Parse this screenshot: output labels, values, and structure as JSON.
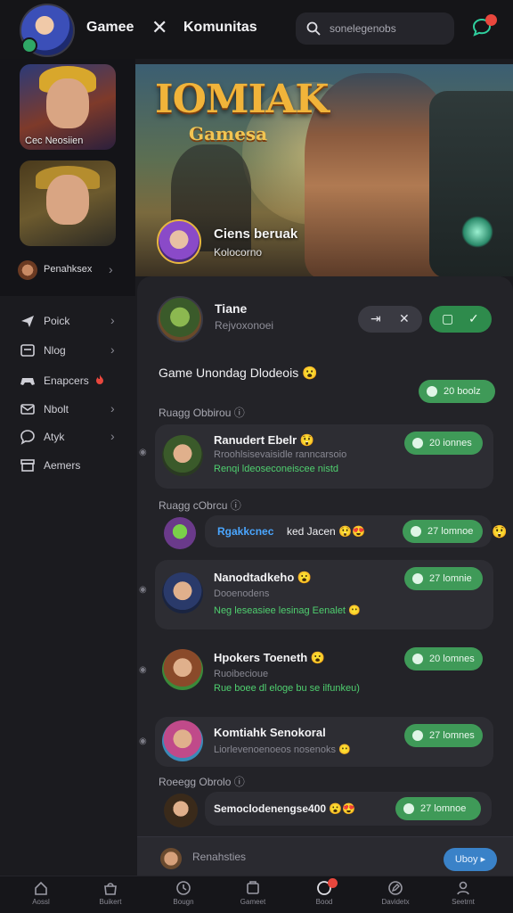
{
  "header": {
    "brand": "Gamee",
    "divider_symbol": "✕",
    "community": "Komunitas",
    "search_placeholder": "sonelegenobs"
  },
  "left_panel": {
    "thumbs": [
      {
        "label": "Cec Neosiien"
      },
      {
        "label": ""
      }
    ],
    "user": {
      "name": "Penahksex"
    }
  },
  "sidebar": {
    "items": [
      {
        "label": "Poick",
        "has_chevron": true
      },
      {
        "label": "Nlog",
        "has_chevron": true
      },
      {
        "label": "Enapcers",
        "has_chevron": false
      },
      {
        "label": "Nbolt",
        "has_chevron": true
      },
      {
        "label": "Atyk",
        "has_chevron": true
      },
      {
        "label": "Aemers",
        "has_chevron": false
      }
    ]
  },
  "hero": {
    "logo": "IOMIAK",
    "logo_sub": "Gamesa",
    "title": "Ciens beruak",
    "subtitle": "Kolocorno"
  },
  "panel": {
    "title": "Tiane",
    "subtitle": "Rejvoxonoei",
    "heading": "Game Unondag Dlodeois 😮",
    "heading_pill": "20 boolz",
    "sections": {
      "first": "Ruagg Obbirou ⓘ",
      "second": "Ruagg cObrcu ⓘ",
      "third": "Roeegg Obrolo ⓘ"
    },
    "cards": [
      {
        "name": "Ranudert Ebelr 😲",
        "sub": "Rroohlsisevaisidle ranncarsoio",
        "msg": "Renqi ldeoseconeiscee nistd",
        "pill": "20 ionnes"
      },
      {
        "name": "Nanodtadkeho 😮",
        "sub": "Dooenodens",
        "msg": "Neg leseasiee lesinag Eenalet 😶",
        "pill": "27 lomnie"
      },
      {
        "name": "Hpokers Toeneth 😮",
        "sub": "Ruoibecioue",
        "msg": "Rue boee dl eloge bu se ilfunkeu)",
        "pill": "20 lomnes"
      },
      {
        "name": "Komtiahk Senokoral",
        "sub": "Liorlevenoenoeos nosenoks 😶",
        "msg": "",
        "pill": "27 lomnes"
      }
    ],
    "inline_rows": [
      {
        "text_blue": "Rgakkcnec",
        "text": "ked Jacen 😲😍",
        "pill": "27 lomnoe"
      },
      {
        "text_blue": "",
        "text": "Semoclodenengse400 😮😍",
        "pill": "27 lomnoe"
      }
    ],
    "composer": {
      "placeholder": "Renahsties",
      "send": "Uboy ▸"
    }
  },
  "bottom_nav": [
    {
      "label": "Aossl",
      "icon": "home-icon"
    },
    {
      "label": "Buikert",
      "icon": "shop-icon"
    },
    {
      "label": "Bougn",
      "icon": "clock-icon"
    },
    {
      "label": "Gameet",
      "icon": "cards-icon"
    },
    {
      "label": "Bood",
      "icon": "chat-icon"
    },
    {
      "label": "Davidetx",
      "icon": "edit-icon"
    },
    {
      "label": "Seetrnt",
      "icon": "profile-icon"
    }
  ],
  "colors": {
    "accent_green": "#3f9a58",
    "notification_red": "#e8473d",
    "background": "#1b1b1f",
    "panel": "#232328"
  }
}
